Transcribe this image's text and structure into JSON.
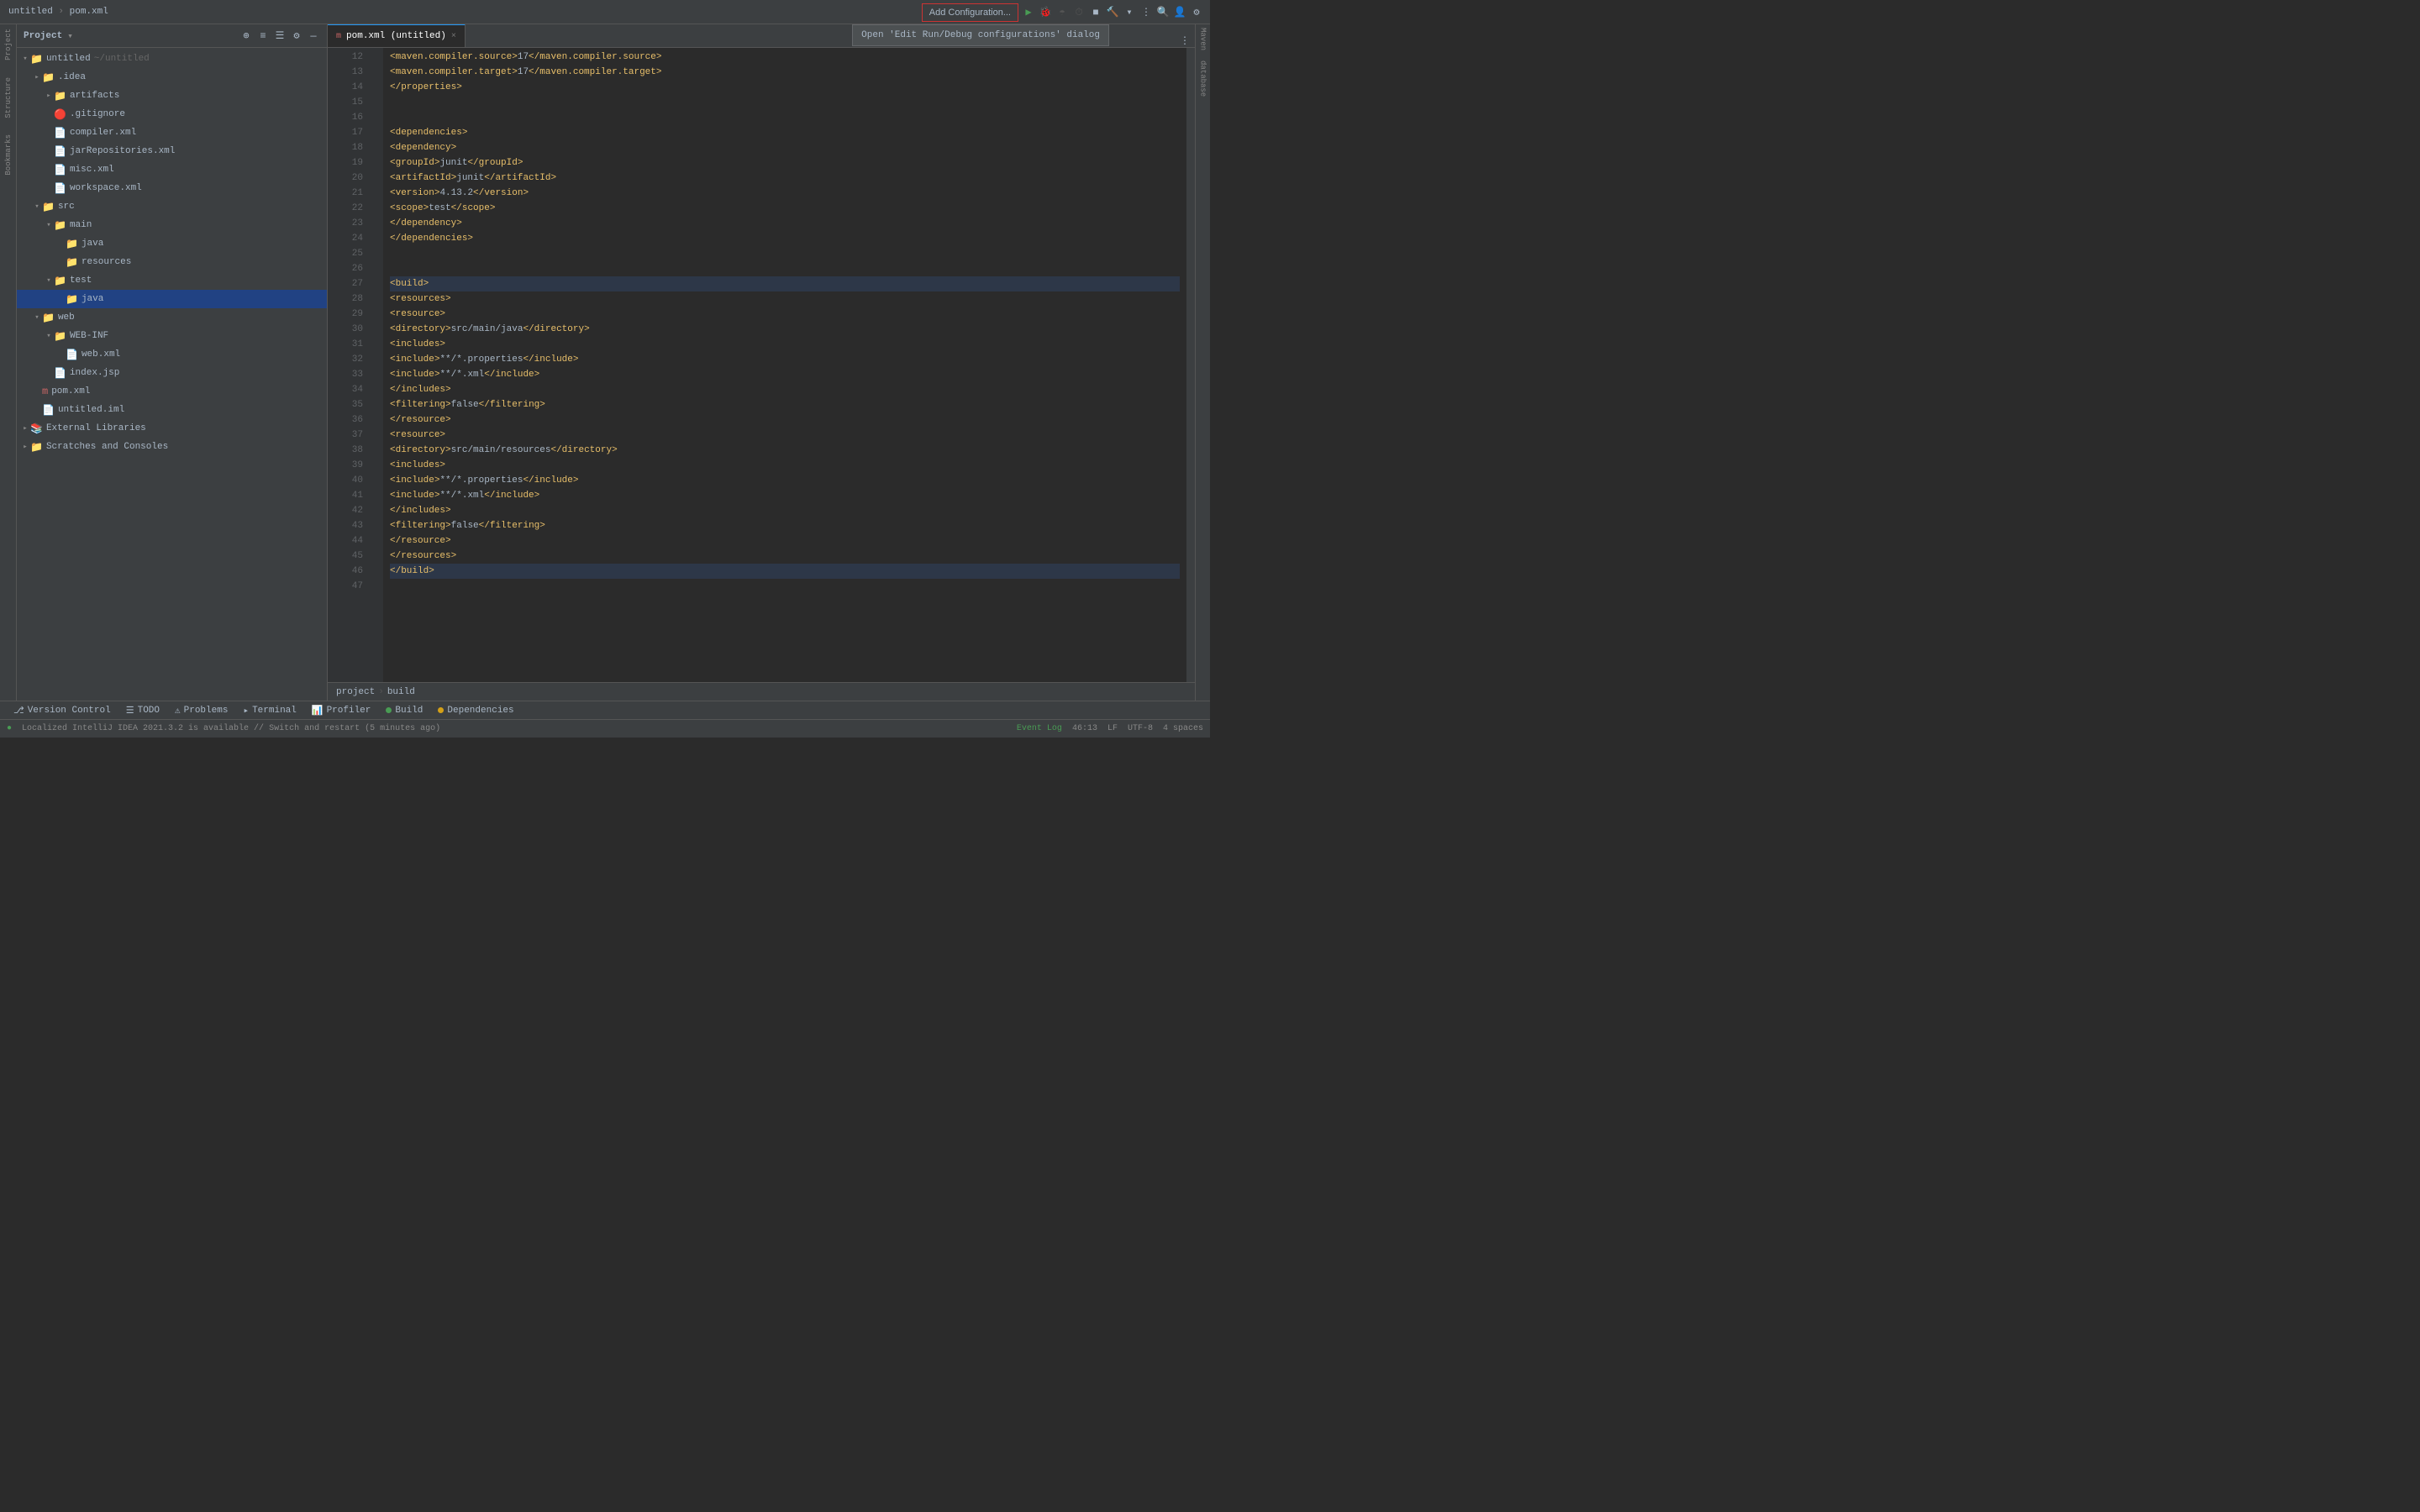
{
  "titleBar": {
    "projectName": "untitled",
    "separator": "›",
    "fileName": "pom.xml",
    "addConfigBtn": "Add Configuration...",
    "tooltip": "Open 'Edit Run/Debug configurations' dialog"
  },
  "projectPanel": {
    "title": "Project",
    "dropdown": "▾",
    "tree": [
      {
        "id": "untitled",
        "level": 0,
        "arrow": "▾",
        "icon": "📁",
        "iconClass": "icon-folder-yellow",
        "label": "untitled",
        "sublabel": "~/untitled",
        "expanded": true
      },
      {
        "id": "idea",
        "level": 1,
        "arrow": "▸",
        "icon": "📁",
        "iconClass": "icon-folder",
        "label": ".idea",
        "expanded": false
      },
      {
        "id": "artifacts",
        "level": 2,
        "arrow": "▸",
        "icon": "📁",
        "iconClass": "icon-folder",
        "label": "artifacts",
        "expanded": false
      },
      {
        "id": "gitignore",
        "level": 2,
        "arrow": "",
        "icon": "🔴",
        "iconClass": "icon-git",
        "label": ".gitignore"
      },
      {
        "id": "compiler",
        "level": 2,
        "arrow": "",
        "icon": "📄",
        "iconClass": "icon-xml",
        "label": "compiler.xml"
      },
      {
        "id": "jarRepositories",
        "level": 2,
        "arrow": "",
        "icon": "📄",
        "iconClass": "icon-xml",
        "label": "jarRepositories.xml"
      },
      {
        "id": "misc",
        "level": 2,
        "arrow": "",
        "icon": "📄",
        "iconClass": "icon-xml",
        "label": "misc.xml"
      },
      {
        "id": "workspace",
        "level": 2,
        "arrow": "",
        "icon": "📄",
        "iconClass": "icon-xml",
        "label": "workspace.xml"
      },
      {
        "id": "src",
        "level": 1,
        "arrow": "▾",
        "icon": "📁",
        "iconClass": "icon-folder",
        "label": "src",
        "expanded": true
      },
      {
        "id": "main",
        "level": 2,
        "arrow": "▾",
        "icon": "📁",
        "iconClass": "icon-folder",
        "label": "main",
        "expanded": true
      },
      {
        "id": "java",
        "level": 3,
        "arrow": "",
        "icon": "📁",
        "iconClass": "icon-folder-green",
        "label": "java"
      },
      {
        "id": "resources",
        "level": 3,
        "arrow": "",
        "icon": "📁",
        "iconClass": "icon-folder-orange",
        "label": "resources"
      },
      {
        "id": "test",
        "level": 2,
        "arrow": "▾",
        "icon": "📁",
        "iconClass": "icon-folder",
        "label": "test",
        "expanded": true
      },
      {
        "id": "test-java",
        "level": 3,
        "arrow": "",
        "icon": "📁",
        "iconClass": "icon-folder-green",
        "label": "java",
        "selected": true
      },
      {
        "id": "web",
        "level": 1,
        "arrow": "▾",
        "icon": "📁",
        "iconClass": "icon-folder",
        "label": "web",
        "expanded": true
      },
      {
        "id": "webinf",
        "level": 2,
        "arrow": "▾",
        "icon": "📁",
        "iconClass": "icon-folder",
        "label": "WEB-INF",
        "expanded": true
      },
      {
        "id": "webxml",
        "level": 3,
        "arrow": "",
        "icon": "📄",
        "iconClass": "icon-xml",
        "label": "web.xml"
      },
      {
        "id": "indexjsp",
        "level": 2,
        "arrow": "",
        "icon": "📄",
        "iconClass": "icon-java",
        "label": "index.jsp"
      },
      {
        "id": "pomxml",
        "level": 1,
        "arrow": "",
        "icon": "m",
        "iconClass": "icon-maven",
        "label": "pom.xml"
      },
      {
        "id": "untitled-iml",
        "level": 1,
        "arrow": "",
        "icon": "📄",
        "iconClass": "icon-xml",
        "label": "untitled.iml"
      },
      {
        "id": "ext-libs",
        "level": 0,
        "arrow": "▸",
        "icon": "📚",
        "iconClass": "icon-lib",
        "label": "External Libraries"
      },
      {
        "id": "scratches",
        "level": 0,
        "arrow": "▸",
        "icon": "📁",
        "iconClass": "icon-scratch",
        "label": "Scratches and Consoles"
      }
    ]
  },
  "editorTab": {
    "icon": "m",
    "label": "pom.xml (untitled)",
    "modified": false
  },
  "codeLines": [
    {
      "num": 12,
      "content": "            <maven.compiler.source>17</maven.compiler.source>"
    },
    {
      "num": 13,
      "content": "            <maven.compiler.target>17</maven.compiler.target>"
    },
    {
      "num": 14,
      "content": "        </properties>"
    },
    {
      "num": 15,
      "content": ""
    },
    {
      "num": 16,
      "content": ""
    },
    {
      "num": 17,
      "content": "    <dependencies>"
    },
    {
      "num": 18,
      "content": "        <dependency>"
    },
    {
      "num": 19,
      "content": "            <groupId>junit</groupId>"
    },
    {
      "num": 20,
      "content": "            <artifactId>junit</artifactId>"
    },
    {
      "num": 21,
      "content": "            <version>4.13.2</version>"
    },
    {
      "num": 22,
      "content": "            <scope>test</scope>"
    },
    {
      "num": 23,
      "content": "        </dependency>"
    },
    {
      "num": 24,
      "content": "    </dependencies>"
    },
    {
      "num": 25,
      "content": ""
    },
    {
      "num": 26,
      "content": ""
    },
    {
      "num": 27,
      "content": "    <build>",
      "highlighted": true
    },
    {
      "num": 28,
      "content": "        <resources>"
    },
    {
      "num": 29,
      "content": "            <resource>"
    },
    {
      "num": 30,
      "content": "                <directory>src/main/java</directory>"
    },
    {
      "num": 31,
      "content": "                <includes>"
    },
    {
      "num": 32,
      "content": "                    <include>**/*.properties</include>"
    },
    {
      "num": 33,
      "content": "                    <include>**/*.xml</include>"
    },
    {
      "num": 34,
      "content": "                </includes>"
    },
    {
      "num": 35,
      "content": "                <filtering>false</filtering>"
    },
    {
      "num": 36,
      "content": "            </resource>"
    },
    {
      "num": 37,
      "content": "            <resource>"
    },
    {
      "num": 38,
      "content": "                <directory>src/main/resources</directory>"
    },
    {
      "num": 39,
      "content": "                <includes>"
    },
    {
      "num": 40,
      "content": "                    <include>**/*.properties</include>"
    },
    {
      "num": 41,
      "content": "                    <include>**/*.xml</include>"
    },
    {
      "num": 42,
      "content": "                </includes>"
    },
    {
      "num": 43,
      "content": "                <filtering>false</filtering>"
    },
    {
      "num": 44,
      "content": "            </resource>"
    },
    {
      "num": 45,
      "content": "        </resources>"
    },
    {
      "num": 46,
      "content": "    </build>",
      "highlighted": true
    },
    {
      "num": 47,
      "content": ""
    }
  ],
  "breadcrumb": {
    "items": [
      "project",
      "build"
    ]
  },
  "bottomTabs": [
    {
      "label": "Version Control",
      "icon": "⎇",
      "active": false
    },
    {
      "label": "TODO",
      "icon": "☰",
      "active": false
    },
    {
      "label": "Problems",
      "icon": "⚠",
      "active": false
    },
    {
      "label": "Terminal",
      "icon": "▸",
      "active": false
    },
    {
      "label": "Profiler",
      "icon": "📊",
      "active": false
    },
    {
      "label": "Build",
      "icon": "🔨",
      "dot": "green",
      "active": false
    },
    {
      "label": "Dependencies",
      "icon": "⚙",
      "dot": "yellow",
      "active": false
    }
  ],
  "statusBar": {
    "message": "Localized IntelliJ IDEA 2021.3.2 is available // Switch and restart (5 minutes ago)",
    "eventLog": "Event Log",
    "position": "46:13",
    "lineEnding": "LF",
    "encoding": "UTF-8",
    "indent": "4 spaces"
  },
  "rightStrip": {
    "labels": [
      "Maven",
      "database"
    ]
  }
}
